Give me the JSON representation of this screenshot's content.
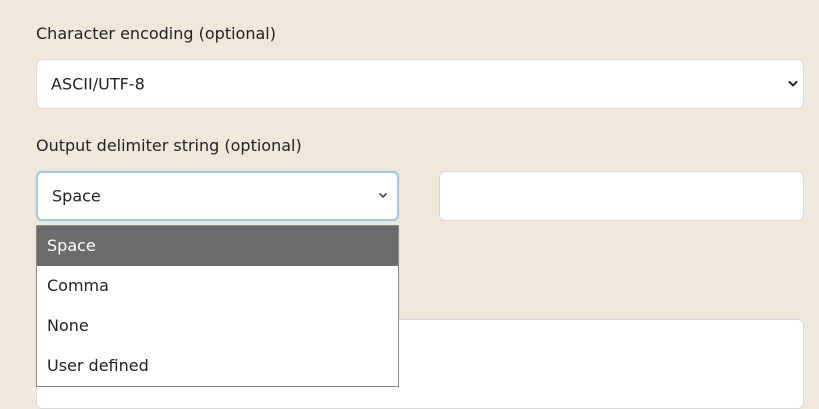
{
  "character_encoding": {
    "label": "Character encoding (optional)",
    "selected_value": "ASCII/UTF-8",
    "dropdown_icon": "chevron-down-icon"
  },
  "output_delimiter": {
    "label": "Output delimiter string (optional)",
    "selected_value": "Space",
    "dropdown_icon": "chevron-down-icon",
    "custom_input_value": "",
    "options": [
      {
        "label": "Space",
        "selected": true
      },
      {
        "label": "Comma",
        "selected": false
      },
      {
        "label": "None",
        "selected": false
      },
      {
        "label": "User defined",
        "selected": false
      }
    ]
  },
  "colors": {
    "background": "#efe8db",
    "selected_option": "#6b6b6b",
    "focus_ring": "#a9c6e5"
  }
}
